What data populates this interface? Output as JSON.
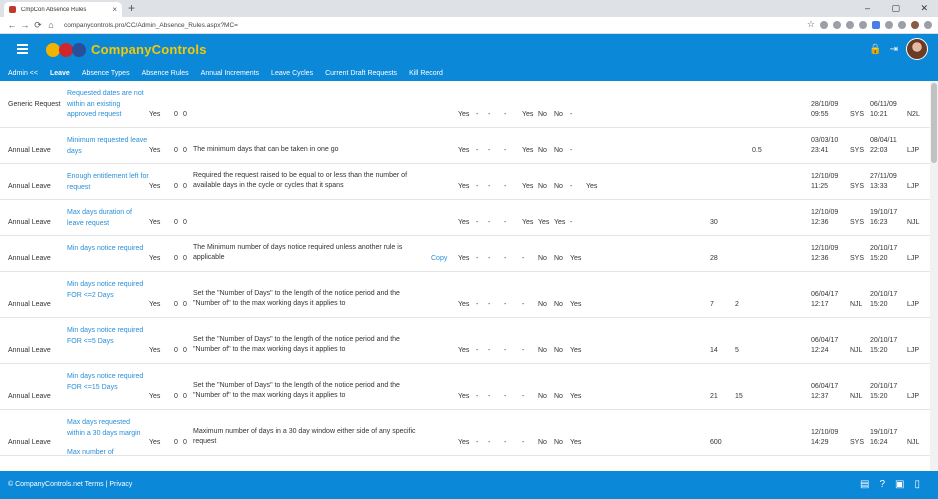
{
  "browser": {
    "tab_title": "CmpCon Absence Rules",
    "tab_close": "×",
    "new_tab": "+",
    "url": "companycontrols.pro/CC/Admin_Absence_Rules.aspx?MC=",
    "back": "←",
    "forward": "→",
    "reload": "⟳",
    "home": "⌂",
    "star": "☆",
    "minimize": "–",
    "maximize": "▢",
    "close": "✕"
  },
  "app": {
    "brand": "CompanyControls",
    "lock_icon": "🔒",
    "logout_icon": "⇥"
  },
  "menu": [
    {
      "label": "Admin <<",
      "active": false
    },
    {
      "label": "Leave",
      "active": true
    },
    {
      "label": "Absence Types",
      "active": false
    },
    {
      "label": "Absence Rules",
      "active": false
    },
    {
      "label": "Annual Increments",
      "active": false
    },
    {
      "label": "Leave Cycles",
      "active": false
    },
    {
      "label": "Current Draft Requests",
      "active": false
    },
    {
      "label": "Kill Record",
      "active": false
    }
  ],
  "rows": [
    {
      "type": "Generic Request",
      "rule": "Requested dates are not within an existing approved request",
      "yes1": "Yes",
      "n1": "0",
      "n2": "0",
      "desc": "",
      "copy": "",
      "f1": "Yes",
      "f2": "-",
      "f3": "-",
      "f4": "-",
      "f5": "Yes",
      "f6": "No",
      "f7": "No",
      "f8": "-",
      "v1": "",
      "v2": "",
      "v3": "",
      "created_date": "28/10/09",
      "created_time": "09:55",
      "created_by": "",
      "modified_date": "06/11/09",
      "modified_time": "10:21",
      "modified_by": "SYS",
      "who": "N2L"
    },
    {
      "type": "Annual Leave",
      "rule": "Minimum requested leave days",
      "yes1": "Yes",
      "n1": "0",
      "n2": "0",
      "desc": "The minimum days that can be taken in one go",
      "copy": "",
      "f1": "Yes",
      "f2": "-",
      "f3": "-",
      "f4": "-",
      "f5": "Yes",
      "f6": "No",
      "f7": "No",
      "f8": "-",
      "v1": "",
      "v2": "",
      "v3": "0.5",
      "created_date": "03/03/10",
      "created_time": "23:41",
      "created_by": "",
      "modified_date": "08/04/11",
      "modified_time": "22:03",
      "modified_by": "SYS",
      "who": "LJP"
    },
    {
      "type": "Annual Leave",
      "rule": "Enough entitlement left for request",
      "yes1": "Yes",
      "n1": "0",
      "n2": "0",
      "desc": "Required the request raised to be equal to or less than the number of available days in the cycle or cycles that it spans",
      "copy": "",
      "f1": "Yes",
      "f2": "-",
      "f3": "-",
      "f4": "-",
      "f5": "Yes",
      "f6": "No",
      "f7": "No",
      "f8": "-",
      "f9": "Yes",
      "v1": "",
      "v2": "",
      "v3": "",
      "created_date": "12/10/09",
      "created_time": "11:25",
      "created_by": "",
      "modified_date": "27/11/09",
      "modified_time": "13:33",
      "modified_by": "SYS",
      "who": "LJP"
    },
    {
      "type": "Annual Leave",
      "rule": "Max days duration of leave request",
      "yes1": "Yes",
      "n1": "0",
      "n2": "0",
      "desc": "",
      "copy": "",
      "f1": "Yes",
      "f2": "-",
      "f3": "-",
      "f4": "-",
      "f5": "Yes",
      "f6": "Yes",
      "f7": "Yes",
      "f8": "-",
      "v1": "30",
      "v2": "",
      "v3": "",
      "created_date": "12/10/09",
      "created_time": "12:36",
      "created_by": "",
      "modified_date": "19/10/17",
      "modified_time": "16:23",
      "modified_by": "SYS",
      "who": "NJL"
    },
    {
      "type": "Annual Leave",
      "rule": "Min days notice required",
      "yes1": "Yes",
      "n1": "0",
      "n2": "0",
      "desc": "The Minimum number of days notice required unless another rule is applicable",
      "copy": "Copy",
      "f1": "Yes",
      "f2": "-",
      "f3": "-",
      "f4": "-",
      "f5": "-",
      "f6": "No",
      "f7": "No",
      "f8": "Yes",
      "v1": "28",
      "v2": "",
      "v3": "",
      "created_date": "12/10/09",
      "created_time": "12:36",
      "created_by": "",
      "modified_date": "20/10/17",
      "modified_time": "15:20",
      "modified_by": "SYS",
      "who": "LJP"
    },
    {
      "type": "Annual Leave",
      "rule": "Min days notice required FOR <=2 Days",
      "yes1": "Yes",
      "n1": "0",
      "n2": "0",
      "desc": "Set the \"Number of Days\" to the length of the notice period and the \"Number of\" to the max working days it applies to",
      "copy": "",
      "f1": "Yes",
      "f2": "-",
      "f3": "-",
      "f4": "-",
      "f5": "-",
      "f6": "No",
      "f7": "No",
      "f8": "Yes",
      "v1": "7",
      "v2": "2",
      "v3": "",
      "created_date": "06/04/17",
      "created_time": "12:17",
      "created_by": "NJL",
      "modified_date": "20/10/17",
      "modified_time": "15:20",
      "modified_by": "",
      "who": "LJP"
    },
    {
      "type": "Annual Leave",
      "rule": "Min days notice required FOR <=5 Days",
      "yes1": "Yes",
      "n1": "0",
      "n2": "0",
      "desc": "Set the \"Number of Days\" to the length of the notice period and the \"Number of\" to the max working days it applies to",
      "copy": "",
      "f1": "Yes",
      "f2": "-",
      "f3": "-",
      "f4": "-",
      "f5": "-",
      "f6": "No",
      "f7": "No",
      "f8": "Yes",
      "v1": "14",
      "v2": "5",
      "v3": "",
      "created_date": "06/04/17",
      "created_time": "12:24",
      "created_by": "NJL",
      "modified_date": "20/10/17",
      "modified_time": "15:20",
      "modified_by": "",
      "who": "LJP"
    },
    {
      "type": "Annual Leave",
      "rule": "Min days notice required FOR <=15 Days",
      "yes1": "Yes",
      "n1": "0",
      "n2": "0",
      "desc": "Set the \"Number of Days\" to the length of the notice period and the \"Number of\" to the max working days it applies to",
      "copy": "",
      "f1": "Yes",
      "f2": "-",
      "f3": "-",
      "f4": "-",
      "f5": "-",
      "f6": "No",
      "f7": "No",
      "f8": "Yes",
      "v1": "21",
      "v2": "15",
      "v3": "",
      "created_date": "06/04/17",
      "created_time": "12:37",
      "created_by": "NJL",
      "modified_date": "20/10/17",
      "modified_time": "15:20",
      "modified_by": "",
      "who": "LJP"
    },
    {
      "type": "Annual Leave",
      "rule": "Max days requested within a 30 days margin",
      "yes1": "Yes",
      "n1": "0",
      "n2": "0",
      "desc": "Maximum number of days in a 30 day window either side of any specific request",
      "copy": "",
      "f1": "Yes",
      "f2": "-",
      "f3": "-",
      "f4": "-",
      "f5": "-",
      "f6": "No",
      "f7": "No",
      "f8": "Yes",
      "v1": "600",
      "v2": "",
      "v3": "",
      "created_date": "12/10/09",
      "created_time": "14:29",
      "created_by": "",
      "modified_date": "19/10/17",
      "modified_time": "16:24",
      "modified_by": "SYS",
      "who": "NJL"
    },
    {
      "type": "",
      "rule": "Max number of",
      "yes1": "",
      "n1": "",
      "n2": "",
      "desc": "",
      "copy": "",
      "f1": "",
      "f2": "",
      "f3": "",
      "f4": "",
      "f5": "",
      "f6": "",
      "f7": "",
      "f8": "",
      "v1": "",
      "v2": "",
      "v3": "",
      "created_date": "",
      "created_time": "",
      "created_by": "",
      "modified_date": "",
      "modified_time": "",
      "modified_by": "",
      "who": ""
    }
  ],
  "footer": {
    "text": "© CompanyControls.net Terms | Privacy"
  }
}
